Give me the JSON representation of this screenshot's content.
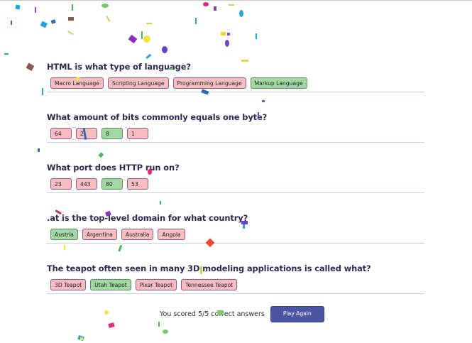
{
  "quiz": {
    "questions": [
      {
        "text": "HTML is what type of language?",
        "answers": [
          {
            "label": "Macro Language",
            "correct": false
          },
          {
            "label": "Scripting Language",
            "correct": false
          },
          {
            "label": "Programming Language",
            "correct": false
          },
          {
            "label": "Markup Language",
            "correct": true
          }
        ]
      },
      {
        "text": "What amount of bits commonly equals one byte?",
        "answers": [
          {
            "label": "64",
            "correct": false
          },
          {
            "label": "2",
            "correct": false
          },
          {
            "label": "8",
            "correct": true
          },
          {
            "label": "1",
            "correct": false
          }
        ]
      },
      {
        "text": "What port does HTTP run on?",
        "answers": [
          {
            "label": "23",
            "correct": false
          },
          {
            "label": "443",
            "correct": false
          },
          {
            "label": "80",
            "correct": true
          },
          {
            "label": "53",
            "correct": false
          }
        ]
      },
      {
        "text": ".at is the top-level domain for what country?",
        "answers": [
          {
            "label": "Austria",
            "correct": true
          },
          {
            "label": "Argentina",
            "correct": false
          },
          {
            "label": "Australia",
            "correct": false
          },
          {
            "label": "Angola",
            "correct": false
          }
        ]
      },
      {
        "text": "The teapot often seen in many 3D modeling applications is called what?",
        "answers": [
          {
            "label": "3D Teapot",
            "correct": false
          },
          {
            "label": "Utah Teapot",
            "correct": true
          },
          {
            "label": "Pixar Teapot",
            "correct": false
          },
          {
            "label": "Tennessee Teapot",
            "correct": false
          }
        ]
      }
    ]
  },
  "footer": {
    "score_text": "You scored 5/5 correct answers",
    "play_again_label": "Play Again"
  },
  "colors": {
    "question_text": "#2b2a52",
    "answer_wrong": "#f7bdc1",
    "answer_correct": "#a1d8a3",
    "button": "#4c55a2",
    "divider": "#c9d1e6"
  }
}
